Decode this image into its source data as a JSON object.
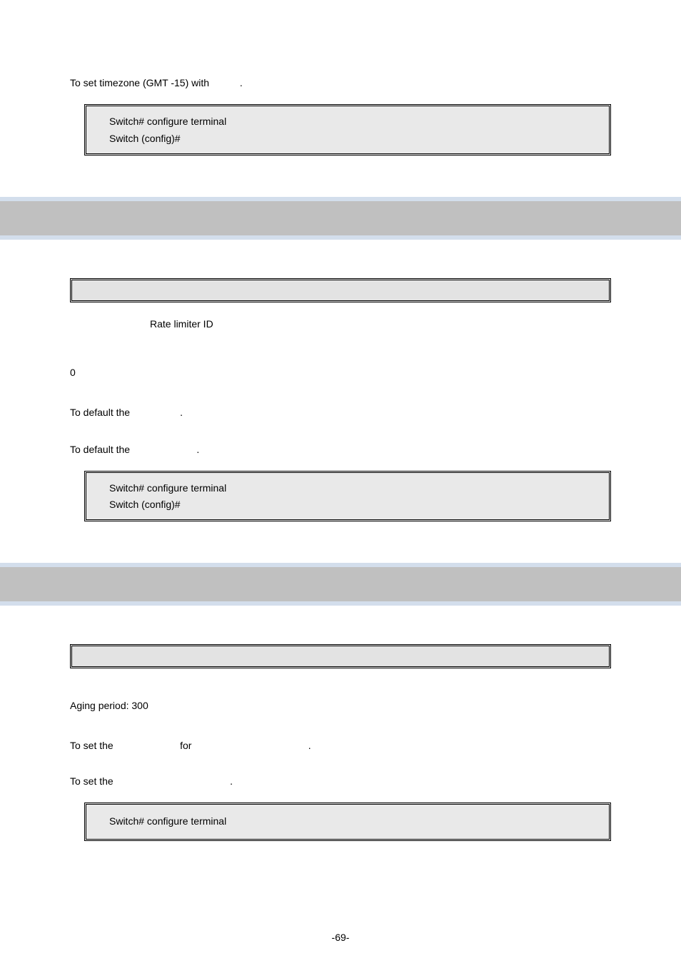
{
  "top": {
    "usage": "To set timezone (GMT -15) with",
    "usage_tail": ".",
    "code1": "Switch# configure terminal",
    "code2": "Switch (config)#"
  },
  "sec1": {
    "param": "Rate limiter ID",
    "default": "0",
    "u1a": "To default the",
    "u1b": ".",
    "u2a": "To default the",
    "u2b": ".",
    "code1": "Switch# configure terminal",
    "code2": "Switch (config)#"
  },
  "sec2": {
    "default": "Aging period: 300",
    "u1a": "To set the",
    "u1b": "for",
    "u1c": ".",
    "u2a": "To set the",
    "u2b": ".",
    "code1": "Switch# configure terminal"
  },
  "footer": "-69-"
}
